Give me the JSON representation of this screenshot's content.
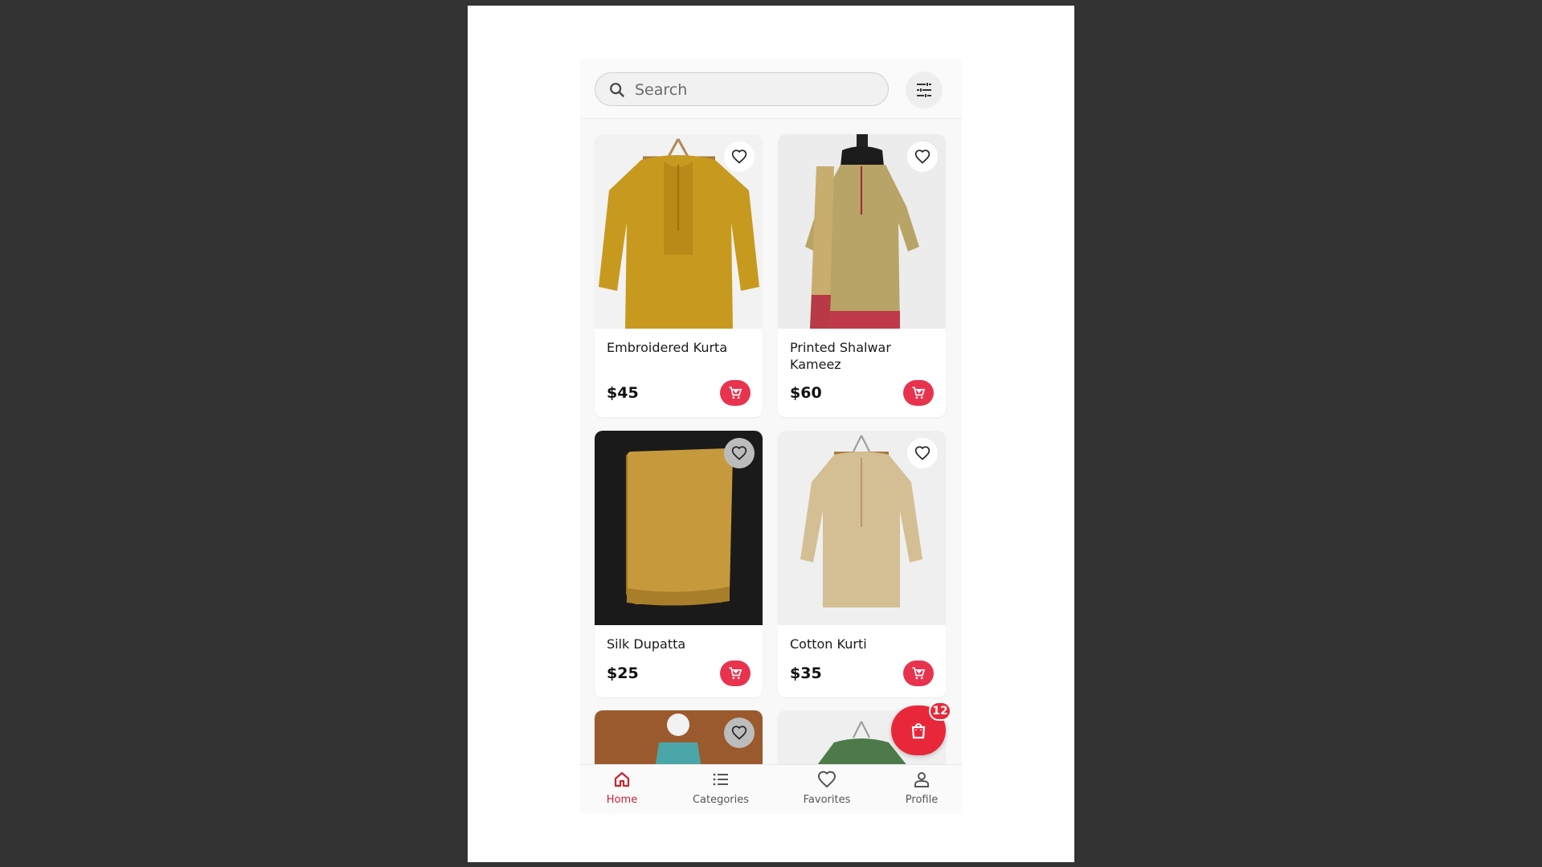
{
  "search": {
    "placeholder": "Search"
  },
  "icons": {
    "search": "search-icon",
    "filter": "tune-sliders-icon",
    "favorite": "heart-outline-icon",
    "cart": "add-shopping-cart-icon",
    "bag": "shopping-bag-icon"
  },
  "colors": {
    "accent": "#e8334f",
    "fab": "#e8283a",
    "active_nav": "#cc2233"
  },
  "products": [
    {
      "name": "Embroidered Kurta",
      "price": "$45"
    },
    {
      "name": "Printed Shalwar Kameez",
      "price": "$60"
    },
    {
      "name": "Silk Dupatta",
      "price": "$25"
    },
    {
      "name": "Cotton Kurti",
      "price": "$35"
    }
  ],
  "cart_badge": "12",
  "nav": [
    {
      "label": "Home",
      "icon": "home-icon",
      "active": true
    },
    {
      "label": "Categories",
      "icon": "list-icon",
      "active": false
    },
    {
      "label": "Favorites",
      "icon": "heart-icon",
      "active": false
    },
    {
      "label": "Profile",
      "icon": "person-icon",
      "active": false
    }
  ]
}
